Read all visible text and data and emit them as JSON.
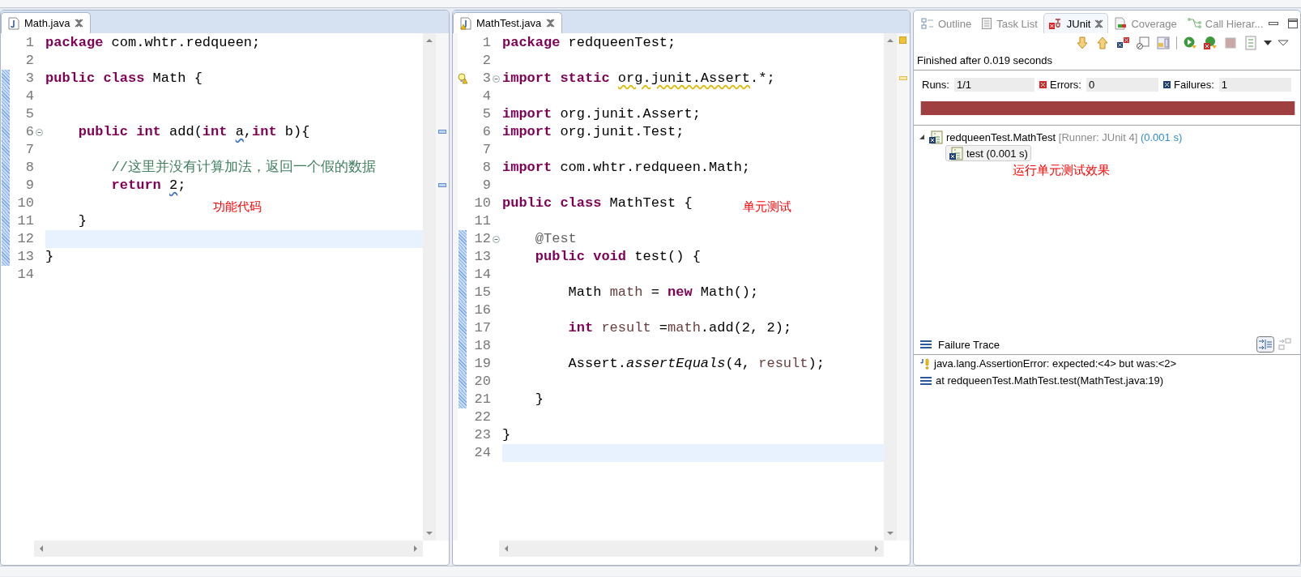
{
  "editors": [
    {
      "tab": {
        "title": "Math.java",
        "selected": true,
        "kind": "java"
      },
      "lines": [
        {
          "number": "1",
          "changed": false,
          "current": false,
          "tokens": [
            {
              "kind": "keyword",
              "text": "package"
            },
            {
              "kind": "plain",
              "text": " com.whtr.redqueen;"
            }
          ]
        },
        {
          "number": "2",
          "changed": false,
          "current": false
        },
        {
          "number": "3",
          "changed": true,
          "current": false,
          "tokens": [
            {
              "kind": "keyword",
              "text": "public class"
            },
            {
              "kind": "plain",
              "text": " Math {"
            }
          ]
        },
        {
          "number": "4",
          "changed": true,
          "current": false
        },
        {
          "number": "5",
          "changed": true,
          "current": false
        },
        {
          "number": "6",
          "changed": true,
          "current": false,
          "folded": false,
          "occurrence": true,
          "tokens": [
            {
              "kind": "keyword",
              "text": "    public int"
            },
            {
              "kind": "plain",
              "text": " add("
            },
            {
              "kind": "keyword",
              "text": "int "
            },
            {
              "kind": "info",
              "text": "a"
            },
            {
              "kind": "plain",
              "text": ","
            },
            {
              "kind": "keyword",
              "text": "int"
            },
            {
              "kind": "plain",
              "text": " b){"
            }
          ]
        },
        {
          "number": "7",
          "changed": true,
          "current": false
        },
        {
          "number": "8",
          "changed": true,
          "current": false,
          "tokens": [
            {
              "kind": "comment",
              "text": "        //这里并没有计算加法，返回一个假的数据"
            }
          ]
        },
        {
          "number": "9",
          "changed": true,
          "current": false,
          "occurrence": true,
          "tokens": [
            {
              "kind": "keyword",
              "text": "        return "
            },
            {
              "kind": "info",
              "text": "2"
            },
            {
              "kind": "plain",
              "text": ";"
            }
          ]
        },
        {
          "number": "10",
          "changed": true,
          "current": false,
          "note": "功能代码"
        },
        {
          "number": "11",
          "changed": true,
          "current": false,
          "tokens": [
            {
              "kind": "plain",
              "text": "    }"
            }
          ]
        },
        {
          "number": "12",
          "changed": true,
          "current": true
        },
        {
          "number": "13",
          "changed": true,
          "current": false,
          "tokens": [
            {
              "kind": "plain",
              "text": "}"
            }
          ]
        },
        {
          "number": "14",
          "changed": false,
          "current": false
        }
      ]
    },
    {
      "tab": {
        "title": "MathTest.java",
        "selected": true,
        "kind": "java-warning"
      },
      "lines": [
        {
          "number": "1",
          "changed": false,
          "current": false,
          "tokens": [
            {
              "kind": "keyword",
              "text": "package"
            },
            {
              "kind": "plain",
              "text": " redqueenTest;"
            }
          ]
        },
        {
          "number": "2",
          "changed": false,
          "current": false
        },
        {
          "number": "3",
          "changed": false,
          "current": false,
          "folded": false,
          "warning": true,
          "tokens": [
            {
              "kind": "keyword",
              "text": "import static "
            },
            {
              "kind": "warning",
              "text": "org.junit.Assert"
            },
            {
              "kind": "plain",
              "text": ".*;"
            }
          ]
        },
        {
          "number": "4",
          "changed": false,
          "current": false
        },
        {
          "number": "5",
          "changed": false,
          "current": false,
          "tokens": [
            {
              "kind": "keyword",
              "text": "import"
            },
            {
              "kind": "plain",
              "text": " org.junit.Assert;"
            }
          ]
        },
        {
          "number": "6",
          "changed": false,
          "current": false,
          "tokens": [
            {
              "kind": "keyword",
              "text": "import"
            },
            {
              "kind": "plain",
              "text": " org.junit.Test;"
            }
          ]
        },
        {
          "number": "7",
          "changed": false,
          "current": false
        },
        {
          "number": "8",
          "changed": false,
          "current": false,
          "tokens": [
            {
              "kind": "keyword",
              "text": "import"
            },
            {
              "kind": "plain",
              "text": " com.whtr.redqueen.Math;"
            }
          ]
        },
        {
          "number": "9",
          "changed": false,
          "current": false
        },
        {
          "number": "10",
          "changed": false,
          "current": false,
          "note": "单元测试",
          "tokens": [
            {
              "kind": "keyword",
              "text": "public class"
            },
            {
              "kind": "plain",
              "text": " MathTest {"
            }
          ]
        },
        {
          "number": "11",
          "changed": false,
          "current": false
        },
        {
          "number": "12",
          "changed": true,
          "current": false,
          "folded": false,
          "tokens": [
            {
              "kind": "annotation",
              "text": "    @Test"
            }
          ]
        },
        {
          "number": "13",
          "changed": true,
          "current": false,
          "tokens": [
            {
              "kind": "keyword",
              "text": "    public void"
            },
            {
              "kind": "plain",
              "text": " test() {"
            }
          ]
        },
        {
          "number": "14",
          "changed": true,
          "current": false
        },
        {
          "number": "15",
          "changed": true,
          "current": false,
          "tokens": [
            {
              "kind": "plain",
              "text": "        Math "
            },
            {
              "kind": "local",
              "text": "math"
            },
            {
              "kind": "plain",
              "text": " = "
            },
            {
              "kind": "keyword",
              "text": "new"
            },
            {
              "kind": "plain",
              "text": " Math();"
            }
          ]
        },
        {
          "number": "16",
          "changed": true,
          "current": false
        },
        {
          "number": "17",
          "changed": true,
          "current": false,
          "tokens": [
            {
              "kind": "keyword",
              "text": "        int "
            },
            {
              "kind": "local",
              "text": "result"
            },
            {
              "kind": "plain",
              "text": " ="
            },
            {
              "kind": "local",
              "text": "math"
            },
            {
              "kind": "plain",
              "text": ".add(2, 2);"
            }
          ]
        },
        {
          "number": "18",
          "changed": true,
          "current": false
        },
        {
          "number": "19",
          "changed": true,
          "current": false,
          "tokens": [
            {
              "kind": "plain",
              "text": "        Assert."
            },
            {
              "kind": "static",
              "text": "assertEquals"
            },
            {
              "kind": "plain",
              "text": "(4, "
            },
            {
              "kind": "local",
              "text": "result"
            },
            {
              "kind": "plain",
              "text": ");"
            }
          ]
        },
        {
          "number": "20",
          "changed": true,
          "current": false
        },
        {
          "number": "21",
          "changed": true,
          "current": false,
          "tokens": [
            {
              "kind": "plain",
              "text": "    }"
            }
          ]
        },
        {
          "number": "22",
          "changed": false,
          "current": false
        },
        {
          "number": "23",
          "changed": false,
          "current": false,
          "tokens": [
            {
              "kind": "plain",
              "text": "}"
            }
          ]
        },
        {
          "number": "24",
          "changed": false,
          "current": true
        }
      ]
    }
  ],
  "junit": {
    "views": [
      {
        "label": "Outline",
        "kind": "outline",
        "selected": false
      },
      {
        "label": "Task List",
        "kind": "tasks",
        "selected": false
      },
      {
        "label": "JUnit",
        "kind": "junit",
        "selected": true
      },
      {
        "label": "Coverage",
        "kind": "coverage",
        "selected": false
      },
      {
        "label": "Call Hierar...",
        "kind": "hierarchy",
        "selected": false
      }
    ],
    "status": "Finished after 0.019 seconds",
    "counters": [
      {
        "kind": "runs",
        "label": "Runs:",
        "value": "1/1"
      },
      {
        "kind": "errors",
        "label": "Errors:",
        "value": "0"
      },
      {
        "kind": "failures",
        "label": "Failures:",
        "value": "1"
      }
    ],
    "progress": {
      "level": 1,
      "failed": true
    },
    "tree": [
      {
        "label": "redqueenTest.MathTest",
        "runner": "[Runner: JUnit 4]",
        "time": "(0.001 s)",
        "expanded": true,
        "selected": false,
        "children": [
          {
            "label": "test (0.001 s)",
            "selected": true
          }
        ]
      }
    ],
    "note": "运行单元测试效果",
    "trace": {
      "title": "Failure Trace",
      "lines": [
        {
          "kind": "error",
          "text": "java.lang.AssertionError: expected:<4> but was:<2>"
        },
        {
          "kind": "frame",
          "text": "at redqueenTest.MathTest.test(MathTest.java:19)"
        }
      ]
    }
  }
}
